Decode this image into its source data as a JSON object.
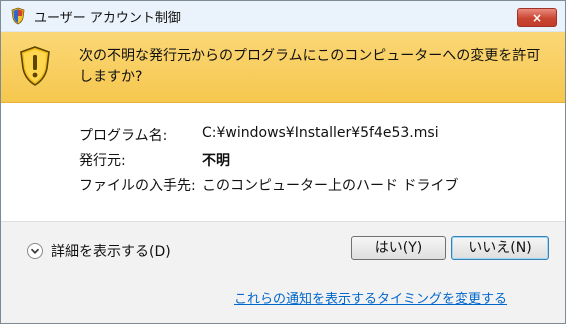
{
  "window": {
    "title": "ユーザー アカウント制御",
    "close_label": "×"
  },
  "warning": {
    "message": "次の不明な発行元からのプログラムにこのコンピューターへの変更を許可しますか?"
  },
  "details": {
    "rows": [
      {
        "label": "プログラム名:",
        "value": "C:¥windows¥Installer¥5f4e53.msi"
      },
      {
        "label": "発行元:",
        "value": "不明"
      },
      {
        "label": "ファイルの入手先:",
        "value": "このコンピューター上のハード ドライブ"
      }
    ]
  },
  "footer": {
    "details_toggle": "詳細を表示する(D)",
    "yes_button": "はい(Y)",
    "no_button": "いいえ(N)",
    "notification_link": "これらの通知を表示するタイミングを変更する"
  },
  "icons": {
    "shield": "security-shield-icon",
    "warning_shield": "warning-shield-icon",
    "details": "chevron-down-icon"
  },
  "colors": {
    "banner": "#f5c74e",
    "title_bar": "#eaf3fb",
    "close_button": "#c94632",
    "link": "#0066cc",
    "footer": "#f2f2f2"
  }
}
